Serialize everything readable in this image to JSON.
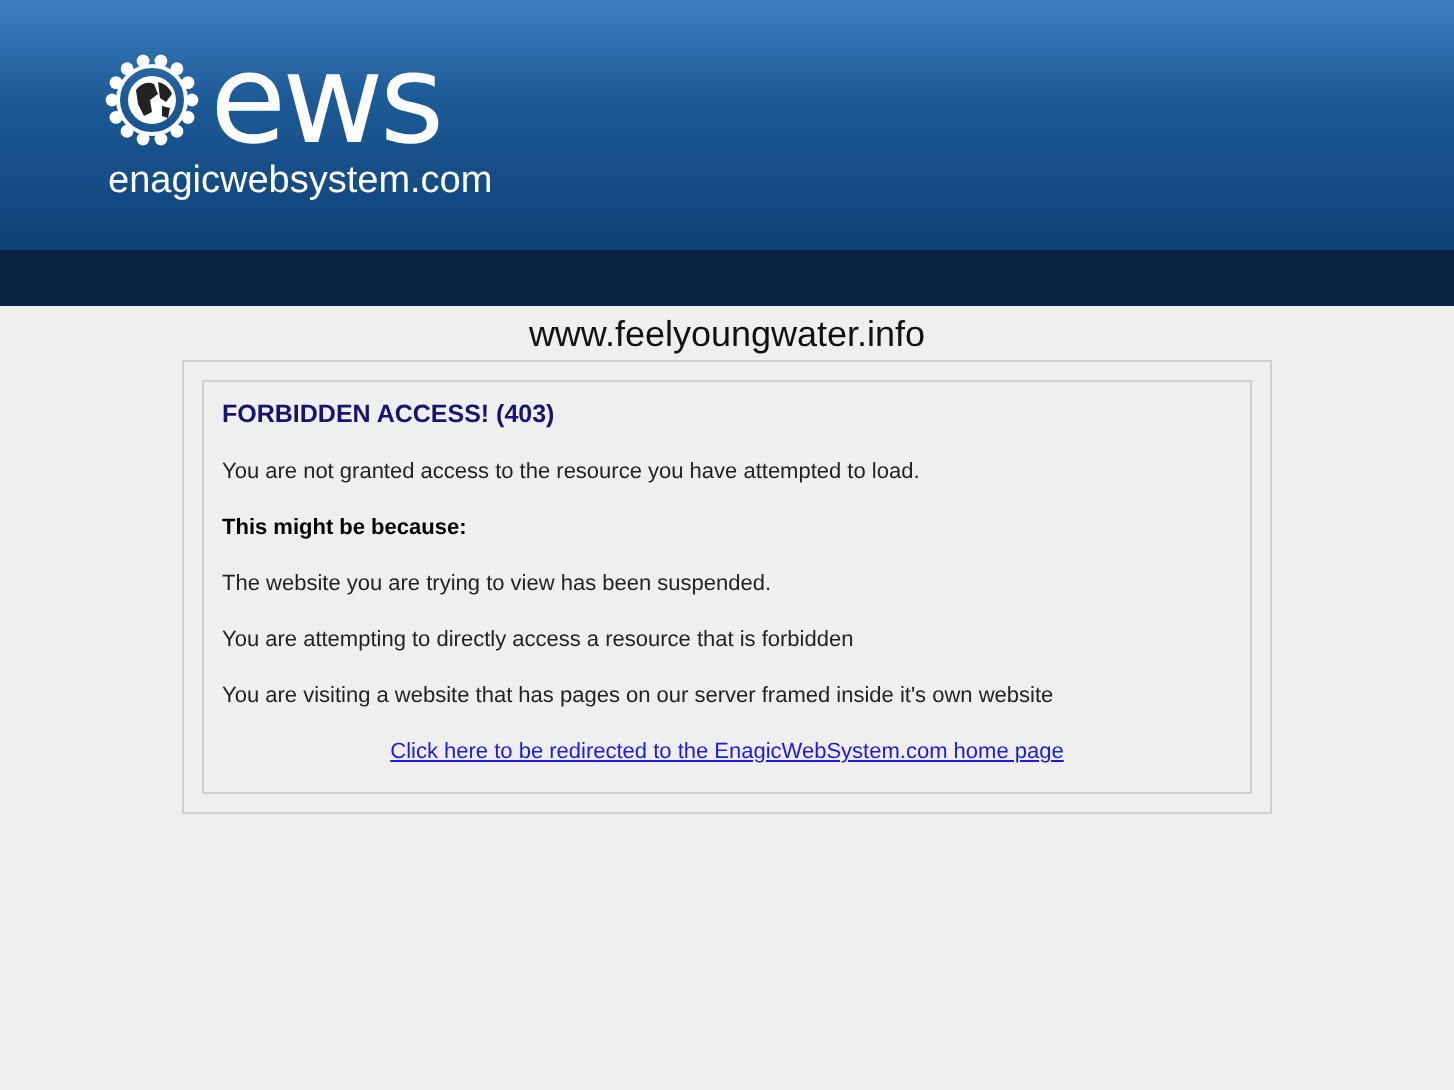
{
  "header": {
    "logo_wordmark": "ews",
    "logo_domain": "enagicwebsystem.com"
  },
  "site_name": "www.feelyoungwater.info",
  "error": {
    "title": "FORBIDDEN ACCESS! (403)",
    "message": "You are not granted access to the resource you have attempted to load.",
    "reasons_heading": "This might be because:",
    "reasons": [
      "The website you are trying to view has been suspended.",
      "You are attempting to directly access a resource that is forbidden",
      "You are visiting a website that has pages on our server framed inside it's own website"
    ],
    "link": "Click here to be redirected to the EnagicWebSystem.com home page"
  }
}
